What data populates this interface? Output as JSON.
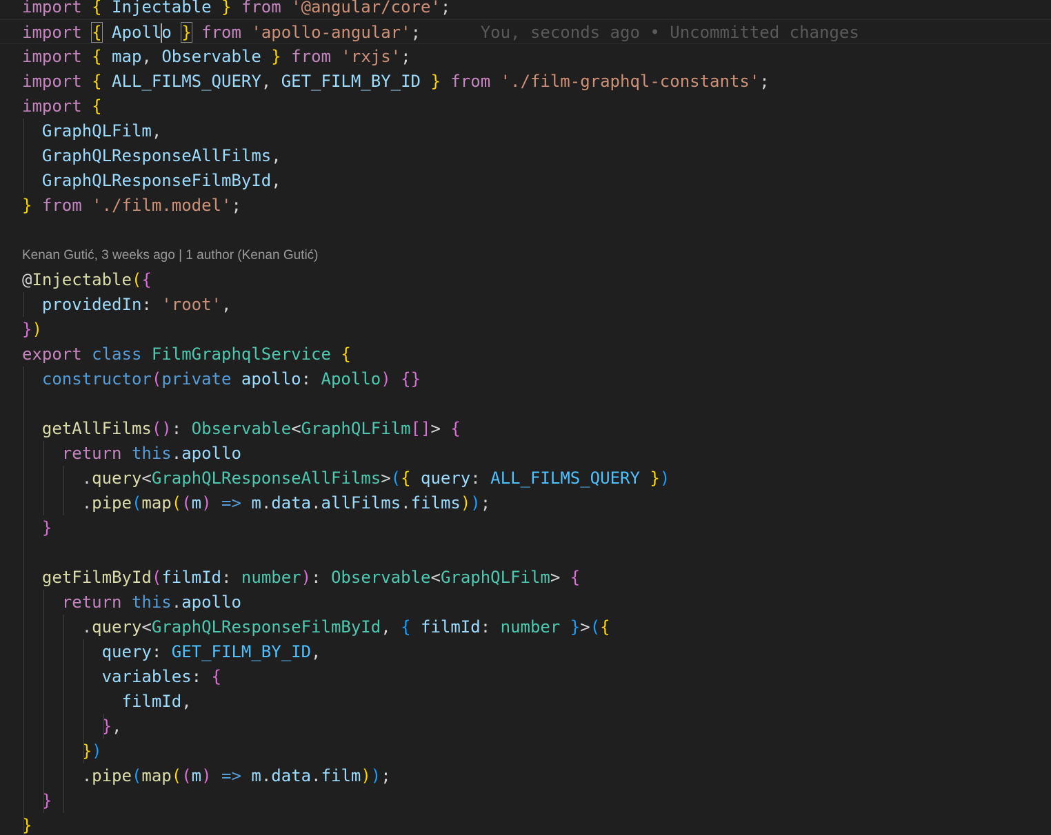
{
  "colors": {
    "background": "#1f1f1f",
    "keyword": "#c586c0",
    "storage": "#569cd6",
    "type": "#4ec9b0",
    "function": "#dcdcaa",
    "variable": "#9cdcfe",
    "constant": "#4fc1ff",
    "string": "#ce9178",
    "punctuation": "#d4d4d4",
    "bracket1": "#ffd700",
    "bracket2": "#da70d6",
    "bracket3": "#179fff",
    "muted": "#5a5a5a"
  },
  "blame": {
    "inline": "You, seconds ago • Uncommitted changes",
    "codelens": "Kenan Gutić, 3 weeks ago | 1 author (Kenan Gutić)"
  },
  "code_lines": [
    {
      "tokens": [
        {
          "t": "import",
          "c": "keyword"
        },
        {
          "t": " ",
          "c": "punctuation"
        },
        {
          "t": "{",
          "c": "bracket1"
        },
        {
          "t": " Injectable ",
          "c": "variable"
        },
        {
          "t": "}",
          "c": "bracket1"
        },
        {
          "t": " ",
          "c": "punctuation"
        },
        {
          "t": "from",
          "c": "keyword"
        },
        {
          "t": " ",
          "c": "punctuation"
        },
        {
          "t": "'@angular/core'",
          "c": "string"
        },
        {
          "t": ";",
          "c": "punctuation"
        }
      ]
    },
    {
      "tokens": [
        {
          "t": "import",
          "c": "keyword"
        },
        {
          "t": " ",
          "c": "punctuation"
        },
        {
          "t": "{",
          "c": "bracket1",
          "box": true
        },
        {
          "t": " Apollo",
          "c": "variable",
          "cursorAfter": 5
        },
        {
          "t": " ",
          "c": "punctuation"
        },
        {
          "t": "}",
          "c": "bracket1",
          "box": true
        },
        {
          "t": " ",
          "c": "punctuation"
        },
        {
          "t": "from",
          "c": "keyword"
        },
        {
          "t": " ",
          "c": "punctuation"
        },
        {
          "t": "'apollo-angular'",
          "c": "string"
        },
        {
          "t": ";",
          "c": "punctuation"
        }
      ]
    },
    {
      "tokens": [
        {
          "t": "import",
          "c": "keyword"
        },
        {
          "t": " ",
          "c": "punctuation"
        },
        {
          "t": "{",
          "c": "bracket1"
        },
        {
          "t": " map",
          "c": "variable"
        },
        {
          "t": ", ",
          "c": "punctuation"
        },
        {
          "t": "Observable",
          "c": "variable"
        },
        {
          "t": " ",
          "c": "punctuation"
        },
        {
          "t": "}",
          "c": "bracket1"
        },
        {
          "t": " ",
          "c": "punctuation"
        },
        {
          "t": "from",
          "c": "keyword"
        },
        {
          "t": " ",
          "c": "punctuation"
        },
        {
          "t": "'rxjs'",
          "c": "string"
        },
        {
          "t": ";",
          "c": "punctuation"
        }
      ]
    },
    {
      "tokens": [
        {
          "t": "import",
          "c": "keyword"
        },
        {
          "t": " ",
          "c": "punctuation"
        },
        {
          "t": "{",
          "c": "bracket1"
        },
        {
          "t": " ALL_FILMS_QUERY",
          "c": "variable"
        },
        {
          "t": ", ",
          "c": "punctuation"
        },
        {
          "t": "GET_FILM_BY_ID",
          "c": "variable"
        },
        {
          "t": " ",
          "c": "punctuation"
        },
        {
          "t": "}",
          "c": "bracket1"
        },
        {
          "t": " ",
          "c": "punctuation"
        },
        {
          "t": "from",
          "c": "keyword"
        },
        {
          "t": " ",
          "c": "punctuation"
        },
        {
          "t": "'./film-graphql-constants'",
          "c": "string"
        },
        {
          "t": ";",
          "c": "punctuation"
        }
      ]
    },
    {
      "tokens": [
        {
          "t": "import",
          "c": "keyword"
        },
        {
          "t": " ",
          "c": "punctuation"
        },
        {
          "t": "{",
          "c": "bracket1"
        }
      ]
    },
    {
      "tokens": [
        {
          "t": "  GraphQLFilm",
          "c": "variable"
        },
        {
          "t": ",",
          "c": "punctuation"
        }
      ]
    },
    {
      "tokens": [
        {
          "t": "  GraphQLResponseAllFilms",
          "c": "variable"
        },
        {
          "t": ",",
          "c": "punctuation"
        }
      ]
    },
    {
      "tokens": [
        {
          "t": "  GraphQLResponseFilmById",
          "c": "variable"
        },
        {
          "t": ",",
          "c": "punctuation"
        }
      ]
    },
    {
      "tokens": [
        {
          "t": "}",
          "c": "bracket1"
        },
        {
          "t": " ",
          "c": "punctuation"
        },
        {
          "t": "from",
          "c": "keyword"
        },
        {
          "t": " ",
          "c": "punctuation"
        },
        {
          "t": "'./film.model'",
          "c": "string"
        },
        {
          "t": ";",
          "c": "punctuation"
        }
      ]
    },
    {
      "tokens": []
    },
    {
      "tokens": [
        {
          "t": "@",
          "c": "punctuation"
        },
        {
          "t": "Injectable",
          "c": "function"
        },
        {
          "t": "(",
          "c": "bracket1"
        },
        {
          "t": "{",
          "c": "bracket2"
        }
      ]
    },
    {
      "tokens": [
        {
          "t": "  providedIn",
          "c": "variable"
        },
        {
          "t": ": ",
          "c": "punctuation"
        },
        {
          "t": "'root'",
          "c": "string"
        },
        {
          "t": ",",
          "c": "punctuation"
        }
      ]
    },
    {
      "tokens": [
        {
          "t": "}",
          "c": "bracket2"
        },
        {
          "t": ")",
          "c": "bracket1"
        }
      ]
    },
    {
      "tokens": [
        {
          "t": "export",
          "c": "keyword"
        },
        {
          "t": " ",
          "c": "punctuation"
        },
        {
          "t": "class",
          "c": "storage"
        },
        {
          "t": " ",
          "c": "punctuation"
        },
        {
          "t": "FilmGraphqlService",
          "c": "type"
        },
        {
          "t": " ",
          "c": "punctuation"
        },
        {
          "t": "{",
          "c": "bracket1"
        }
      ]
    },
    {
      "tokens": [
        {
          "t": "  ",
          "c": "punctuation"
        },
        {
          "t": "constructor",
          "c": "storage"
        },
        {
          "t": "(",
          "c": "bracket2"
        },
        {
          "t": "private",
          "c": "storage"
        },
        {
          "t": " apollo",
          "c": "variable"
        },
        {
          "t": ": ",
          "c": "punctuation"
        },
        {
          "t": "Apollo",
          "c": "type"
        },
        {
          "t": ")",
          "c": "bracket2"
        },
        {
          "t": " ",
          "c": "punctuation"
        },
        {
          "t": "{}",
          "c": "bracket2"
        }
      ]
    },
    {
      "tokens": []
    },
    {
      "tokens": [
        {
          "t": "  ",
          "c": "punctuation"
        },
        {
          "t": "getAllFilms",
          "c": "function"
        },
        {
          "t": "()",
          "c": "bracket2"
        },
        {
          "t": ": ",
          "c": "punctuation"
        },
        {
          "t": "Observable",
          "c": "type"
        },
        {
          "t": "<",
          "c": "punctuation"
        },
        {
          "t": "GraphQLFilm",
          "c": "type"
        },
        {
          "t": "[]",
          "c": "bracket2"
        },
        {
          "t": "> ",
          "c": "punctuation"
        },
        {
          "t": "{",
          "c": "bracket2"
        }
      ]
    },
    {
      "tokens": [
        {
          "t": "    ",
          "c": "punctuation"
        },
        {
          "t": "return",
          "c": "keyword"
        },
        {
          "t": " ",
          "c": "punctuation"
        },
        {
          "t": "this",
          "c": "storage"
        },
        {
          "t": ".",
          "c": "punctuation"
        },
        {
          "t": "apollo",
          "c": "variable"
        }
      ]
    },
    {
      "tokens": [
        {
          "t": "      .",
          "c": "punctuation"
        },
        {
          "t": "query",
          "c": "function"
        },
        {
          "t": "<",
          "c": "punctuation"
        },
        {
          "t": "GraphQLResponseAllFilms",
          "c": "type"
        },
        {
          "t": ">",
          "c": "punctuation"
        },
        {
          "t": "(",
          "c": "bracket3"
        },
        {
          "t": "{",
          "c": "bracket1"
        },
        {
          "t": " query",
          "c": "variable"
        },
        {
          "t": ": ",
          "c": "punctuation"
        },
        {
          "t": "ALL_FILMS_QUERY",
          "c": "constant"
        },
        {
          "t": " ",
          "c": "punctuation"
        },
        {
          "t": "}",
          "c": "bracket1"
        },
        {
          "t": ")",
          "c": "bracket3"
        }
      ]
    },
    {
      "tokens": [
        {
          "t": "      .",
          "c": "punctuation"
        },
        {
          "t": "pipe",
          "c": "function"
        },
        {
          "t": "(",
          "c": "bracket3"
        },
        {
          "t": "map",
          "c": "function"
        },
        {
          "t": "(",
          "c": "bracket1"
        },
        {
          "t": "(",
          "c": "bracket2"
        },
        {
          "t": "m",
          "c": "variable"
        },
        {
          "t": ")",
          "c": "bracket2"
        },
        {
          "t": " ",
          "c": "punctuation"
        },
        {
          "t": "=>",
          "c": "storage"
        },
        {
          "t": " m",
          "c": "variable"
        },
        {
          "t": ".",
          "c": "punctuation"
        },
        {
          "t": "data",
          "c": "variable"
        },
        {
          "t": ".",
          "c": "punctuation"
        },
        {
          "t": "allFilms",
          "c": "variable"
        },
        {
          "t": ".",
          "c": "punctuation"
        },
        {
          "t": "films",
          "c": "variable"
        },
        {
          "t": ")",
          "c": "bracket1"
        },
        {
          "t": ")",
          "c": "bracket3"
        },
        {
          "t": ";",
          "c": "punctuation"
        }
      ]
    },
    {
      "tokens": [
        {
          "t": "  ",
          "c": "punctuation"
        },
        {
          "t": "}",
          "c": "bracket2"
        }
      ]
    },
    {
      "tokens": []
    },
    {
      "tokens": [
        {
          "t": "  ",
          "c": "punctuation"
        },
        {
          "t": "getFilmById",
          "c": "function"
        },
        {
          "t": "(",
          "c": "bracket2"
        },
        {
          "t": "filmId",
          "c": "variable"
        },
        {
          "t": ": ",
          "c": "punctuation"
        },
        {
          "t": "number",
          "c": "type"
        },
        {
          "t": ")",
          "c": "bracket2"
        },
        {
          "t": ": ",
          "c": "punctuation"
        },
        {
          "t": "Observable",
          "c": "type"
        },
        {
          "t": "<",
          "c": "punctuation"
        },
        {
          "t": "GraphQLFilm",
          "c": "type"
        },
        {
          "t": "> ",
          "c": "punctuation"
        },
        {
          "t": "{",
          "c": "bracket2"
        }
      ]
    },
    {
      "tokens": [
        {
          "t": "    ",
          "c": "punctuation"
        },
        {
          "t": "return",
          "c": "keyword"
        },
        {
          "t": " ",
          "c": "punctuation"
        },
        {
          "t": "this",
          "c": "storage"
        },
        {
          "t": ".",
          "c": "punctuation"
        },
        {
          "t": "apollo",
          "c": "variable"
        }
      ]
    },
    {
      "tokens": [
        {
          "t": "      .",
          "c": "punctuation"
        },
        {
          "t": "query",
          "c": "function"
        },
        {
          "t": "<",
          "c": "punctuation"
        },
        {
          "t": "GraphQLResponseFilmById",
          "c": "type"
        },
        {
          "t": ", ",
          "c": "punctuation"
        },
        {
          "t": "{",
          "c": "bracket3"
        },
        {
          "t": " filmId",
          "c": "variable"
        },
        {
          "t": ": ",
          "c": "punctuation"
        },
        {
          "t": "number",
          "c": "type"
        },
        {
          "t": " ",
          "c": "punctuation"
        },
        {
          "t": "}",
          "c": "bracket3"
        },
        {
          "t": ">",
          "c": "punctuation"
        },
        {
          "t": "(",
          "c": "bracket3"
        },
        {
          "t": "{",
          "c": "bracket1"
        }
      ]
    },
    {
      "tokens": [
        {
          "t": "        query",
          "c": "variable"
        },
        {
          "t": ": ",
          "c": "punctuation"
        },
        {
          "t": "GET_FILM_BY_ID",
          "c": "constant"
        },
        {
          "t": ",",
          "c": "punctuation"
        }
      ]
    },
    {
      "tokens": [
        {
          "t": "        variables",
          "c": "variable"
        },
        {
          "t": ": ",
          "c": "punctuation"
        },
        {
          "t": "{",
          "c": "bracket2"
        }
      ]
    },
    {
      "tokens": [
        {
          "t": "          filmId",
          "c": "variable"
        },
        {
          "t": ",",
          "c": "punctuation"
        }
      ]
    },
    {
      "tokens": [
        {
          "t": "        ",
          "c": "punctuation"
        },
        {
          "t": "}",
          "c": "bracket2"
        },
        {
          "t": ",",
          "c": "punctuation"
        }
      ]
    },
    {
      "tokens": [
        {
          "t": "      ",
          "c": "punctuation"
        },
        {
          "t": "}",
          "c": "bracket1"
        },
        {
          "t": ")",
          "c": "bracket3"
        }
      ]
    },
    {
      "tokens": [
        {
          "t": "      .",
          "c": "punctuation"
        },
        {
          "t": "pipe",
          "c": "function"
        },
        {
          "t": "(",
          "c": "bracket3"
        },
        {
          "t": "map",
          "c": "function"
        },
        {
          "t": "(",
          "c": "bracket1"
        },
        {
          "t": "(",
          "c": "bracket2"
        },
        {
          "t": "m",
          "c": "variable"
        },
        {
          "t": ")",
          "c": "bracket2"
        },
        {
          "t": " ",
          "c": "punctuation"
        },
        {
          "t": "=>",
          "c": "storage"
        },
        {
          "t": " m",
          "c": "variable"
        },
        {
          "t": ".",
          "c": "punctuation"
        },
        {
          "t": "data",
          "c": "variable"
        },
        {
          "t": ".",
          "c": "punctuation"
        },
        {
          "t": "film",
          "c": "variable"
        },
        {
          "t": ")",
          "c": "bracket1"
        },
        {
          "t": ")",
          "c": "bracket3"
        },
        {
          "t": ";",
          "c": "punctuation"
        }
      ]
    },
    {
      "tokens": [
        {
          "t": "  ",
          "c": "punctuation"
        },
        {
          "t": "}",
          "c": "bracket2"
        }
      ]
    },
    {
      "tokens": [
        {
          "t": "}",
          "c": "bracket1"
        }
      ]
    }
  ]
}
